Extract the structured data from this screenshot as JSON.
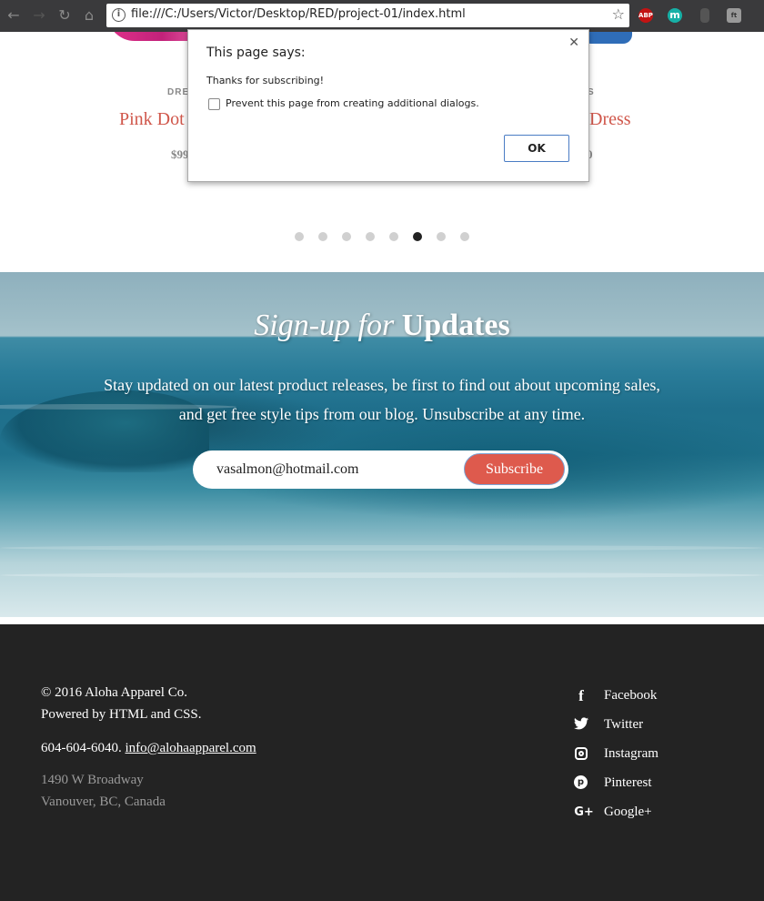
{
  "browser": {
    "url": "file:///C:/Users/Victor/Desktop/RED/project-01/index.html",
    "extensions": [
      "ABP",
      "m",
      "",
      "ft"
    ]
  },
  "products": {
    "left": {
      "category": "DRE",
      "name": "Pink Dot",
      "price": "$99"
    },
    "right": {
      "category": "S",
      "name": "Dress",
      "price": "0"
    },
    "carousel_active_index": 5,
    "carousel_count": 8
  },
  "signup": {
    "title_italic": "Sign-up for",
    "title_bold": "Updates",
    "text_line1": "Stay updated on our latest product releases, be first to find out about upcoming sales,",
    "text_line2": "and get free style tips from our blog. Unsubscribe at any time.",
    "email_value": "vasalmon@hotmail.com",
    "subscribe_label": "Subscribe"
  },
  "footer": {
    "copyright": "© 2016 Aloha Apparel Co.",
    "powered": "Powered by HTML and CSS.",
    "phone": "604-604-6040.",
    "email": "info@alohaapparel.com",
    "address1": "1490 W Broadway",
    "address2": "Vanouver, BC, Canada",
    "social": [
      {
        "label": "Facebook",
        "icon": "facebook-icon"
      },
      {
        "label": "Twitter",
        "icon": "twitter-icon"
      },
      {
        "label": "Instagram",
        "icon": "instagram-icon"
      },
      {
        "label": "Pinterest",
        "icon": "pinterest-icon"
      },
      {
        "label": "Google+",
        "icon": "google-plus-icon"
      }
    ]
  },
  "dialog": {
    "title": "This page says:",
    "message": "Thanks for subscribing!",
    "checkbox_label": "Prevent this page from creating additional dialogs.",
    "ok_label": "OK"
  },
  "colors": {
    "accent": "#de5a4d",
    "product_name": "#d0574b",
    "footer_bg": "#232323"
  }
}
